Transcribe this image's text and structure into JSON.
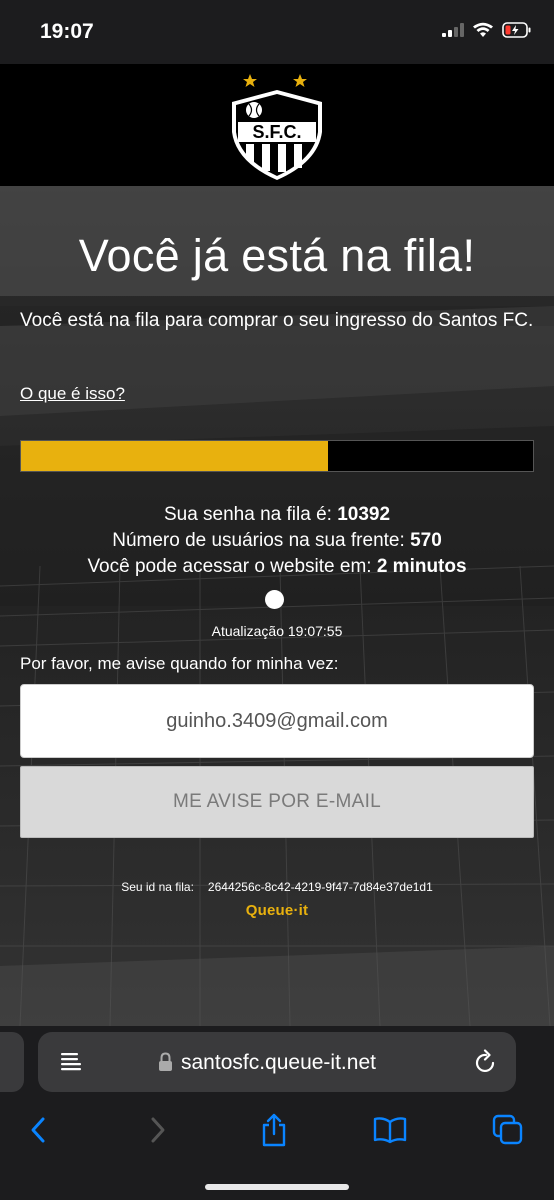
{
  "status_bar": {
    "time": "19:07"
  },
  "header": {
    "logo_text": "S.F.C."
  },
  "main": {
    "title": "Você já está na fila!",
    "intro": "Você está na fila para comprar o seu ingresso do Santos FC.",
    "what_link": "O que é isso?",
    "progress_fraction": 0.6,
    "queue_number_label": "Sua senha na fila é:",
    "queue_number": "10392",
    "users_ahead_label": "Número de usuários na sua frente:",
    "users_ahead": "570",
    "eta_label": "Você pode acessar o website em:",
    "eta": "2 minutos",
    "updated": "Atualização 19:07:55",
    "notify_label": "Por favor, me avise quando for minha vez:",
    "email_value": "guinho.3409@gmail.com",
    "notify_button": "ME AVISE POR E-MAIL",
    "queue_id_label": "Seu id na fila:",
    "queue_id": "2644256c-8c42-4219-9f47-7d84e37de1d1",
    "brand": "Queue·it"
  },
  "browser": {
    "url": "santosfc.queue-it.net"
  },
  "colors": {
    "accent": "#e8b10e",
    "ios_blue": "#0a84ff",
    "battery_red": "#ff3b30"
  }
}
